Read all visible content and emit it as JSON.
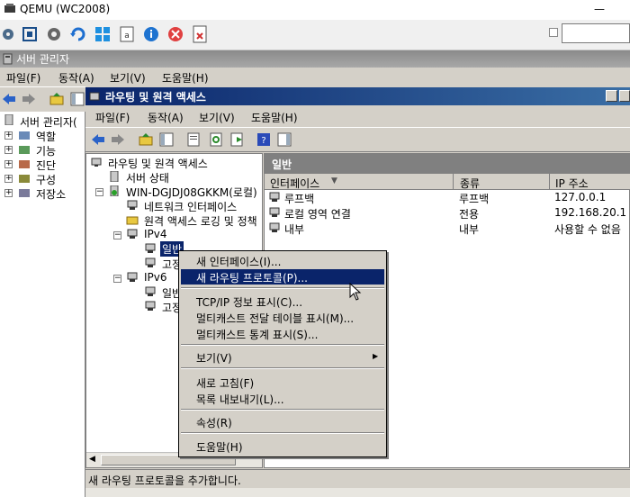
{
  "qemu": {
    "title": "QEMU (WC2008)",
    "minimize": "—"
  },
  "server_manager": {
    "title": "서버 관리자",
    "menu": [
      "파일(F)",
      "동작(A)",
      "보기(V)",
      "도움말(H)"
    ],
    "tree": [
      {
        "label": "서버 관리자(",
        "expander": ""
      },
      {
        "label": "역할",
        "expander": "+"
      },
      {
        "label": "기능",
        "expander": "+"
      },
      {
        "label": "진단",
        "expander": "+"
      },
      {
        "label": "구성",
        "expander": "+"
      },
      {
        "label": "저장소",
        "expander": "+"
      }
    ]
  },
  "rras": {
    "title": "라우팅 및 원격 액세스",
    "menu": [
      "파일(F)",
      "동작(A)",
      "보기(V)",
      "도움말(H)"
    ],
    "tree": [
      {
        "label": "라우팅 및 원격 액세스",
        "expander": ""
      },
      {
        "label": "서버 상태",
        "expander": ""
      },
      {
        "label": "WIN-DGJDJ08GKKM(로컬)",
        "expander": "−"
      },
      {
        "label": "네트워크 인터페이스",
        "expander": ""
      },
      {
        "label": "원격 액세스 로깅 및 정책",
        "expander": ""
      },
      {
        "label": "IPv4",
        "expander": "−"
      },
      {
        "label": "일반",
        "expander": ""
      },
      {
        "label": "고정",
        "expander": ""
      },
      {
        "label": "IPv6",
        "expander": "−"
      },
      {
        "label": "일반",
        "expander": ""
      },
      {
        "label": "고정",
        "expander": ""
      }
    ],
    "panel_title": "일반",
    "columns": [
      "인터페이스",
      "종류",
      "IP 주소"
    ],
    "rows": [
      {
        "iface": "루프백",
        "type": "루프백",
        "ip": "127.0.0.1"
      },
      {
        "iface": "로컬 영역 연결",
        "type": "전용",
        "ip": "192.168.20.1"
      },
      {
        "iface": "내부",
        "type": "내부",
        "ip": "사용할 수 없음"
      }
    ],
    "status": "새 라우팅 프로토콜을 추가합니다."
  },
  "context_menu": {
    "items": [
      "새 인터페이스(I)...",
      "새 라우팅 프로토콜(P)...",
      "TCP/IP 정보 표시(C)...",
      "멀티캐스트 전달 테이블 표시(M)...",
      "멀티캐스트 통계 표시(S)...",
      "보기(V)",
      "새로 고침(F)",
      "목록 내보내기(L)...",
      "속성(R)",
      "도움말(H)"
    ],
    "submenu_arrow": "▶"
  },
  "colors": {
    "selection": "#0a246a",
    "titlebar_active": "#0a246a",
    "panel_header": "#808080"
  }
}
